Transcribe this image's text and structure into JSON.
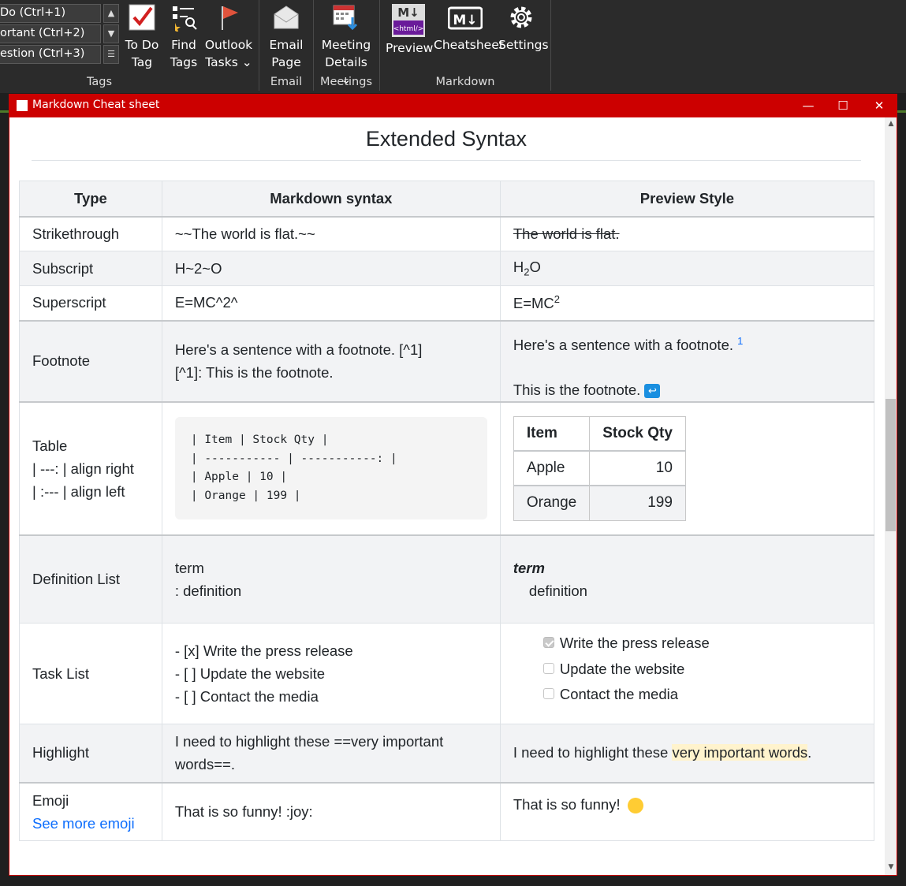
{
  "ribbon": {
    "tag_items": [
      "Do (Ctrl+1)",
      "ortant (Ctrl+2)",
      "estion (Ctrl+3)"
    ],
    "buttons": [
      {
        "l1": "To Do",
        "l2": "Tag",
        "icon": "todo-check-icon"
      },
      {
        "l1": "Find",
        "l2": "Tags",
        "icon": "find-tags-icon"
      },
      {
        "l1": "Outlook",
        "l2": "Tasks ⌄",
        "icon": "outlook-flag-icon"
      },
      {
        "l1": "Email",
        "l2": "Page",
        "icon": "email-envelope-icon"
      },
      {
        "l1": "Meeting",
        "l2": "Details ⌄",
        "icon": "meeting-details-icon"
      },
      {
        "l1": "Preview",
        "l2": "",
        "icon": "markdown-html-preview-icon"
      },
      {
        "l1": "Cheatsheet",
        "l2": "",
        "icon": "markdown-logo-icon"
      },
      {
        "l1": "Settings",
        "l2": "",
        "icon": "gear-icon"
      }
    ],
    "groups": {
      "tags": "Tags",
      "email": "Email",
      "meetings": "Meetings",
      "markdown": "Markdown"
    }
  },
  "window": {
    "title": "Markdown Cheat sheet"
  },
  "page": {
    "heading": "Extended Syntax",
    "headers": [
      "Type",
      "Markdown syntax",
      "Preview Style"
    ],
    "rows": {
      "strike": {
        "type": "Strikethrough",
        "syntax": "~~The world is flat.~~",
        "preview": "The world is flat."
      },
      "sub": {
        "type": "Subscript",
        "syntax": "H~2~O",
        "p1": "H",
        "p2": "2",
        "p3": "O"
      },
      "sup": {
        "type": "Superscript",
        "syntax": "E=MC^2^",
        "p1": "E=MC",
        "p2": "2"
      },
      "foot": {
        "type": "Footnote",
        "s1": "Here's a sentence with a footnote. [^1]",
        "s2": "[^1]: This is the footnote.",
        "p1": "Here's a sentence with a footnote. ",
        "p_ref": "1",
        "p2": "This is the footnote. ",
        "p_back": "↩"
      },
      "table": {
        "t1": "Table",
        "t2": "| ---: | align right",
        "t3": "| :--- | align left",
        "code": "| Item | Stock Qty |\n| ----------- | -----------: |\n| Apple | 10 |\n| Orange | 199 |",
        "h1": "Item",
        "h2": "Stock Qty",
        "r1a": "Apple",
        "r1b": "10",
        "r2a": "Orange",
        "r2b": "199"
      },
      "deflist": {
        "type": "Definition List",
        "s1": "term",
        "s2": ": definition",
        "p1": "term",
        "p2": "definition"
      },
      "task": {
        "type": "Task List",
        "s1": "- [x] Write the press release",
        "s2": "- [ ] Update the website",
        "s3": "- [ ] Contact the media",
        "p1": "Write the press release",
        "p2": "Update the website",
        "p3": "Contact the media"
      },
      "hl": {
        "type": "Highlight",
        "s1": "I need to highlight these ==very important",
        "s2": "words==.",
        "p1": "I need to highlight these ",
        "p2": "very important words",
        "p3": "."
      },
      "emoji": {
        "type": "Emoji",
        "link": "See more emoji",
        "syntax": "That is so funny! :joy:",
        "preview": "That is so funny! "
      }
    }
  }
}
